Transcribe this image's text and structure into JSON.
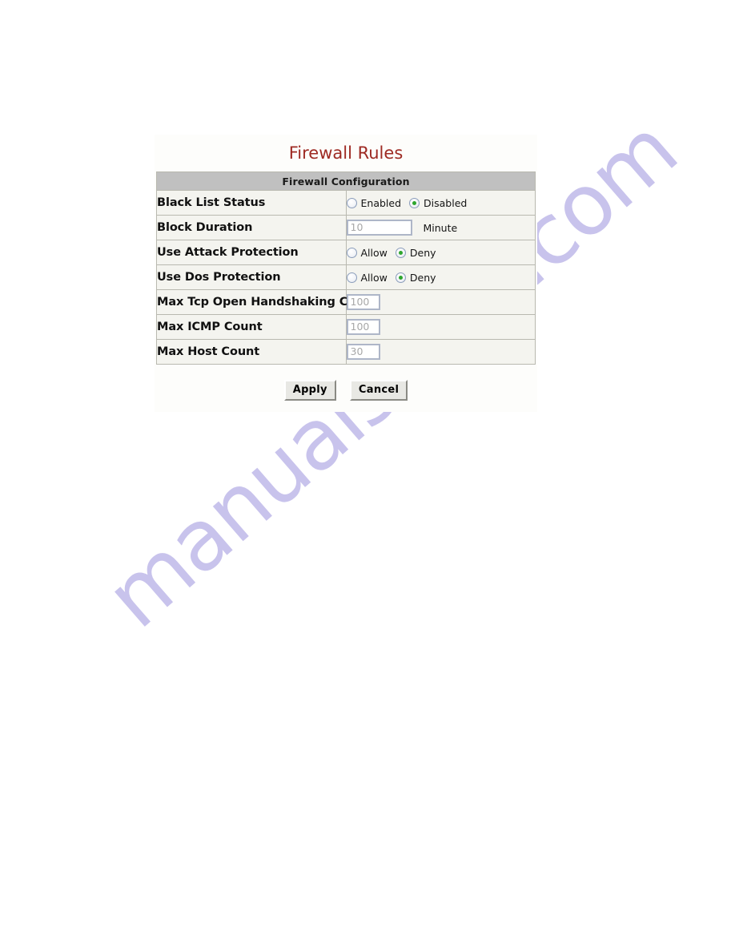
{
  "page": {
    "title": "Firewall Rules",
    "title_color": "#9e2a23",
    "background_color": "#ffffff",
    "panel_color": "#fdfdfb"
  },
  "watermark": {
    "text": "manualshive.com",
    "color": "#c8c3ec"
  },
  "table": {
    "header": "Firewall Configuration",
    "header_background": "#c0c0c0",
    "rows": [
      {
        "label": "Black List Status",
        "type": "radio",
        "options": [
          {
            "label": "Enabled",
            "selected": false
          },
          {
            "label": "Disabled",
            "selected": true
          }
        ]
      },
      {
        "label": "Block Duration",
        "type": "text",
        "value": "10",
        "unit": "Minute"
      },
      {
        "label": "Use Attack Protection",
        "type": "radio",
        "options": [
          {
            "label": "Allow",
            "selected": false
          },
          {
            "label": "Deny",
            "selected": true
          }
        ]
      },
      {
        "label": "Use Dos Protection",
        "type": "radio",
        "options": [
          {
            "label": "Allow",
            "selected": false
          },
          {
            "label": "Deny",
            "selected": true
          }
        ]
      },
      {
        "label": "Max Tcp Open Handshaking Count",
        "type": "text",
        "value": "100",
        "unit": ""
      },
      {
        "label": "Max ICMP Count",
        "type": "text",
        "value": "100",
        "unit": ""
      },
      {
        "label": "Max Host Count",
        "type": "text",
        "value": "30",
        "unit": ""
      }
    ]
  },
  "buttons": {
    "apply_label": "Apply",
    "cancel_label": "Cancel"
  },
  "selected_radio_color": "#2ea62e"
}
